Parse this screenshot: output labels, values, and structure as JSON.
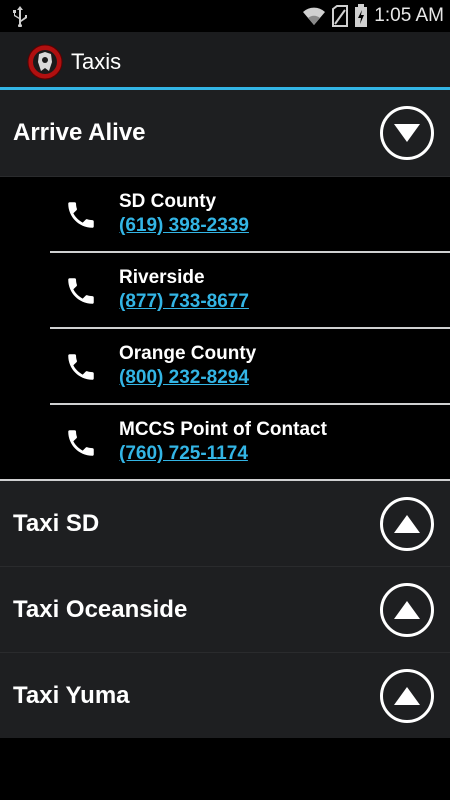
{
  "status_bar": {
    "time": "1:05 AM"
  },
  "action_bar": {
    "title": "Taxis"
  },
  "sections": [
    {
      "title": "Arrive Alive",
      "expanded": true,
      "contacts": [
        {
          "name": "SD County",
          "phone": "(619) 398-2339"
        },
        {
          "name": "Riverside",
          "phone": "(877) 733-8677"
        },
        {
          "name": "Orange County",
          "phone": "(800) 232-8294"
        },
        {
          "name": "MCCS Point of Contact",
          "phone": "(760) 725-1174"
        }
      ]
    },
    {
      "title": "Taxi SD",
      "expanded": false
    },
    {
      "title": "Taxi Oceanside",
      "expanded": false
    },
    {
      "title": "Taxi Yuma",
      "expanded": false
    }
  ],
  "colors": {
    "accent": "#33b5e5",
    "header_bg": "#1e1f21",
    "action_bar_bg": "#1b1c1e"
  },
  "icons": [
    "usb-icon",
    "wifi-icon",
    "no-sim-icon",
    "battery-icon",
    "app-logo",
    "phone-icon",
    "chevron-down-icon",
    "chevron-up-icon"
  ]
}
